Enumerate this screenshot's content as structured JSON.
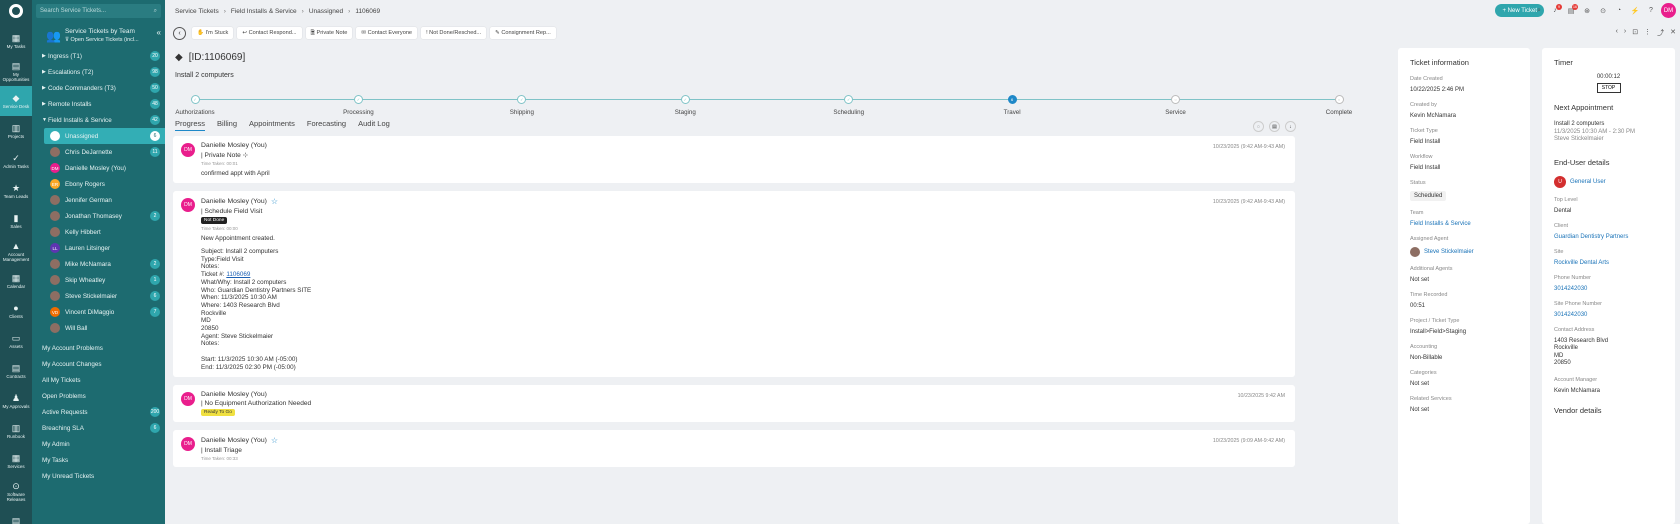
{
  "rail": [
    {
      "icon": "▦",
      "label": "My Tasks"
    },
    {
      "icon": "▤",
      "label": "My Opportunities"
    },
    {
      "icon": "◆",
      "label": "Service Desk",
      "active": true
    },
    {
      "icon": "▥",
      "label": "Projects"
    },
    {
      "icon": "✓",
      "label": "Admin Tasks"
    },
    {
      "icon": "★",
      "label": "Team Leads"
    },
    {
      "icon": "▮",
      "label": "Sales"
    },
    {
      "icon": "▲",
      "label": "Account Management"
    },
    {
      "icon": "▦",
      "label": "Calendar"
    },
    {
      "icon": "●",
      "label": "Clients"
    },
    {
      "icon": "▭",
      "label": "Assets"
    },
    {
      "icon": "▤",
      "label": "Contracts"
    },
    {
      "icon": "♟",
      "label": "My Approvals"
    },
    {
      "icon": "▥",
      "label": "Runbook"
    },
    {
      "icon": "▦",
      "label": "Services"
    },
    {
      "icon": "⊙",
      "label": "Software Releases"
    },
    {
      "icon": "▤",
      "label": ""
    }
  ],
  "search": {
    "placeholder": "Search Service Tickets..."
  },
  "panel": {
    "title": "Service Tickets by Team",
    "filter": "Open Service Tickets (incl...",
    "groups": [
      {
        "label": "Ingress (T1)",
        "count": "20"
      },
      {
        "label": "Escalations (T2)",
        "count": "98"
      },
      {
        "label": "Code Commanders (T3)",
        "count": "50"
      },
      {
        "label": "Remote Installs",
        "count": "48"
      },
      {
        "label": "Field Installs & Service",
        "count": "42",
        "open": true
      }
    ],
    "users": [
      {
        "label": "Unassigned",
        "count": "6",
        "selected": true,
        "color": "#ffffff",
        "init": ""
      },
      {
        "label": "Chris DeJarnette",
        "count": "11",
        "color": "#8d6e63",
        "init": ""
      },
      {
        "label": "Danielle Mosley (You)",
        "count": "",
        "color": "#e91e8c",
        "init": "DM"
      },
      {
        "label": "Ebony Rogers",
        "count": "",
        "color": "#f9a825",
        "init": "ER"
      },
      {
        "label": "Jennifer German",
        "count": "",
        "color": "#8d6e63",
        "init": ""
      },
      {
        "label": "Jonathan Thomasey",
        "count": "2",
        "color": "#8d6e63",
        "init": ""
      },
      {
        "label": "Kelly Hibbert",
        "count": "",
        "color": "#8d6e63",
        "init": ""
      },
      {
        "label": "Lauren Litsinger",
        "count": "",
        "color": "#5e35b1",
        "init": "LL"
      },
      {
        "label": "Mike McNamara",
        "count": "2",
        "color": "#8d6e63",
        "init": ""
      },
      {
        "label": "Skip Wheatley",
        "count": "1",
        "color": "#8d6e63",
        "init": ""
      },
      {
        "label": "Steve Stickelmaier",
        "count": "6",
        "color": "#8d6e63",
        "init": ""
      },
      {
        "label": "Vincent DiMaggio",
        "count": "7",
        "color": "#ef6c00",
        "init": "VD"
      },
      {
        "label": "Will Ball",
        "count": "",
        "color": "#8d6e63",
        "init": ""
      }
    ],
    "bottom": [
      {
        "label": "My Account Problems",
        "count": ""
      },
      {
        "label": "My Account Changes",
        "count": ""
      },
      {
        "label": "All My Tickets",
        "count": ""
      },
      {
        "label": "Open Problems",
        "count": ""
      },
      {
        "label": "Active Requests",
        "count": "200"
      },
      {
        "label": "Breaching SLA",
        "count": "6"
      },
      {
        "label": "My Admin",
        "count": ""
      },
      {
        "label": "My Tasks",
        "count": ""
      },
      {
        "label": "My Unread Tickets",
        "count": ""
      }
    ]
  },
  "breadcrumb": [
    "Service Tickets",
    "Field Installs & Service",
    "Unassigned",
    "1106069"
  ],
  "new_ticket": "+ New Ticket",
  "top_icons": [
    {
      "icon": "⌕",
      "badge": ""
    },
    {
      "icon": "♪",
      "badge": "9"
    },
    {
      "icon": "▤",
      "badge": "16"
    },
    {
      "icon": "⊛",
      "badge": ""
    },
    {
      "icon": "⊙",
      "badge": ""
    },
    {
      "icon": "◔",
      "badge": ""
    },
    {
      "icon": "⚡",
      "badge": ""
    },
    {
      "icon": "?",
      "badge": ""
    }
  ],
  "user_initials": "DM",
  "actions": [
    "✋ I'm Stuck",
    "↩ Contact Respond...",
    "🗎 Private Note",
    "✉ Contact Everyone",
    "! Not Done/Resched...",
    "✎ Consignment Rep..."
  ],
  "right_tools": [
    "‹",
    "›",
    "⊡",
    "⋮",
    "⤴",
    "✕"
  ],
  "ticket": {
    "id": "[ID:1106069]",
    "subject": "Install 2 computers"
  },
  "steps": [
    {
      "label": "Authorizations",
      "state": "done"
    },
    {
      "label": "Processing",
      "state": "done"
    },
    {
      "label": "Shipping",
      "state": "done"
    },
    {
      "label": "Staging",
      "state": "done"
    },
    {
      "label": "Scheduling",
      "state": "done"
    },
    {
      "label": "Travel",
      "state": "current"
    },
    {
      "label": "Service",
      "state": "future"
    },
    {
      "label": "Complete",
      "state": "future"
    }
  ],
  "tabs": [
    "Progress",
    "Billing",
    "Appointments",
    "Forecasting",
    "Audit Log"
  ],
  "feed": [
    {
      "name": "Danielle Mosley (You)",
      "date": "10/23/2025 (9:42 AM-9:43 AM)",
      "title": "| Private Note  ⊹",
      "time": "Time Taken: 00:01",
      "text": "confirmed appt with April",
      "star": false,
      "tag": ""
    },
    {
      "name": "Danielle Mosley (You)",
      "date": "10/23/2025 (9:42 AM-9:43 AM)",
      "title": "| Schedule Field Visit",
      "time": "Time Taken: 00:00",
      "text": "New Appointment created.",
      "star": true,
      "tag": "Not Done",
      "link": "1106069",
      "pre1": "Subject: Install 2 computers\nType:Field Visit\nNotes:\nTicket #: ",
      "pre2": "What/Why: Install 2 computers\nWho: Guardian Dentistry Partners SITE\nWhen: 11/3/2025 10:30 AM\nWhere: 1403 Research Blvd\nRockville\nMD\n20850\nAgent: Steve Stickelmaier\nNotes:\n\nStart: 11/3/2025 10:30 AM (-05:00)\nEnd: 11/3/2025 02:30 PM (-05:00)"
    },
    {
      "name": "Danielle Mosley (You)",
      "date": "10/23/2025 9:42 AM",
      "title": "| No Equipment Authorization Needed",
      "time": "",
      "text": "",
      "star": false,
      "tag": "Ready To Go"
    },
    {
      "name": "Danielle Mosley (You)",
      "date": "10/23/2025 (9:09 AM-9:42 AM)",
      "title": "| Install Triage",
      "time": "Time Taken: 00:33",
      "text": "",
      "star": true,
      "tag": ""
    }
  ],
  "info": {
    "title": "Ticket information",
    "fields": [
      {
        "label": "Date Created",
        "value": "10/22/2025 2:46 PM",
        "style": ""
      },
      {
        "label": "Created by",
        "value": "Kevin McNamara",
        "style": ""
      },
      {
        "label": "Ticket Type",
        "value": "Field Install",
        "style": ""
      },
      {
        "label": "Workflow",
        "value": "Field Install",
        "style": ""
      },
      {
        "label": "Status",
        "value": "Scheduled",
        "style": "chip"
      },
      {
        "label": "Team",
        "value": "Field Installs & Service",
        "style": "link"
      },
      {
        "label": "Assigned Agent",
        "value": "Steve Stickelmaier",
        "style": "agent"
      },
      {
        "label": "Additional Agents",
        "value": "Not set",
        "style": ""
      },
      {
        "label": "Time Recorded",
        "value": "00:51",
        "style": ""
      },
      {
        "label": "Project / Ticket Type",
        "value": "Install>Field>Staging",
        "style": ""
      },
      {
        "label": "Accounting",
        "value": "Non-Billable",
        "style": ""
      },
      {
        "label": "Categories",
        "value": "Not set",
        "style": ""
      },
      {
        "label": "Related Services",
        "value": "Not set",
        "style": ""
      }
    ]
  },
  "timer": {
    "title": "Timer",
    "value": "00:00:12",
    "stop": "STOP"
  },
  "next_appt": {
    "title": "Next Appointment",
    "subject": "Install 2 computers",
    "when": "11/3/2025 10:30 AM - 2:30 PM",
    "agent": "Steve Stickelmaier"
  },
  "end_user": {
    "title": "End-User details",
    "initial": "U",
    "name": "General User",
    "fields": [
      {
        "label": "Top Level",
        "value": "Dental",
        "style": ""
      },
      {
        "label": "Client",
        "value": "Guardian Dentistry Partners",
        "style": "link"
      },
      {
        "label": "Site",
        "value": "Rockville Dental Arts",
        "style": "link"
      },
      {
        "label": "Phone Number",
        "value": "3014242030",
        "style": "link"
      },
      {
        "label": "Site Phone Number",
        "value": "3014242030",
        "style": "link"
      }
    ],
    "address_label": "Contact Address",
    "address": [
      "1403 Research Blvd",
      "Rockville",
      "MD",
      "20850"
    ],
    "manager_label": "Account Manager",
    "manager": "Kevin McNamara"
  },
  "vendor": {
    "title": "Vendor details"
  }
}
